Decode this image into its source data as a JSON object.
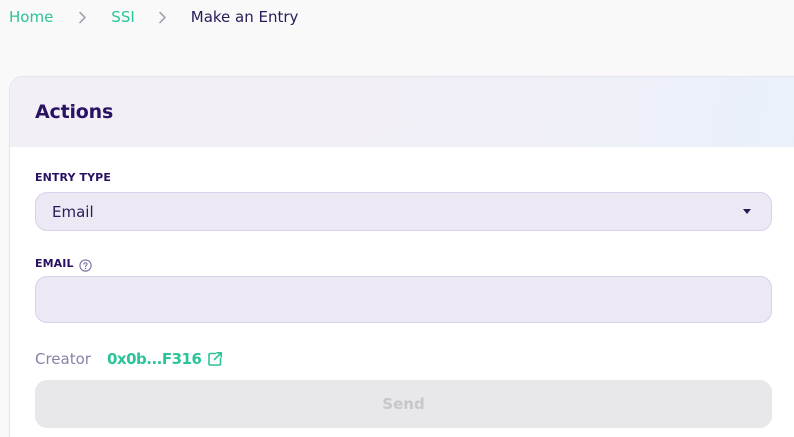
{
  "breadcrumb": {
    "items": [
      {
        "label": "Home"
      },
      {
        "label": "SSI"
      },
      {
        "label": "Make an Entry"
      }
    ]
  },
  "card": {
    "title": "Actions"
  },
  "form": {
    "entry_type_label": "ENTRY TYPE",
    "entry_type_value": "Email",
    "email_label": "EMAIL",
    "email_value": "",
    "creator_label": "Creator",
    "creator_address": "0x0b...F316",
    "send_label": "Send"
  },
  "colors": {
    "accent": "#2bc39a",
    "heading": "#2a1263",
    "input_bg": "#ece8f4"
  },
  "icons": {
    "breadcrumb_separator": "chevron-right-icon",
    "help": "help-circle-icon",
    "dropdown": "caret-down-icon",
    "external": "external-link-icon"
  }
}
